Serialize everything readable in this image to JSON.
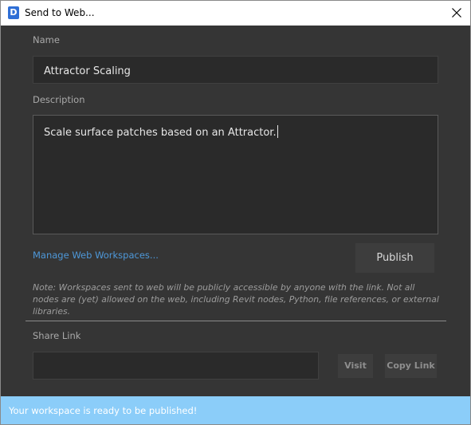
{
  "window": {
    "title": "Send to Web...",
    "app_icon_letter": "D",
    "close_icon": "close-icon"
  },
  "form": {
    "name_label": "Name",
    "name_value": "Attractor Scaling",
    "description_label": "Description",
    "description_value": "Scale surface patches based on an Attractor.",
    "manage_link": "Manage Web Workspaces...",
    "publish_label": "Publish",
    "note": "Note: Workspaces sent to web will be publicly accessible by anyone with the link. Not all nodes are (yet) allowed on the web, including Revit nodes, Python, file references, or external libraries.",
    "share_link_label": "Share Link",
    "share_link_value": "",
    "visit_label": "Visit",
    "copy_link_label": "Copy Link"
  },
  "status": {
    "message": "Your workspace is ready to be published!"
  },
  "colors": {
    "background": "#353535",
    "field": "#2a2a2a",
    "link": "#4e98d9",
    "status_bar": "#8bcdf9"
  }
}
